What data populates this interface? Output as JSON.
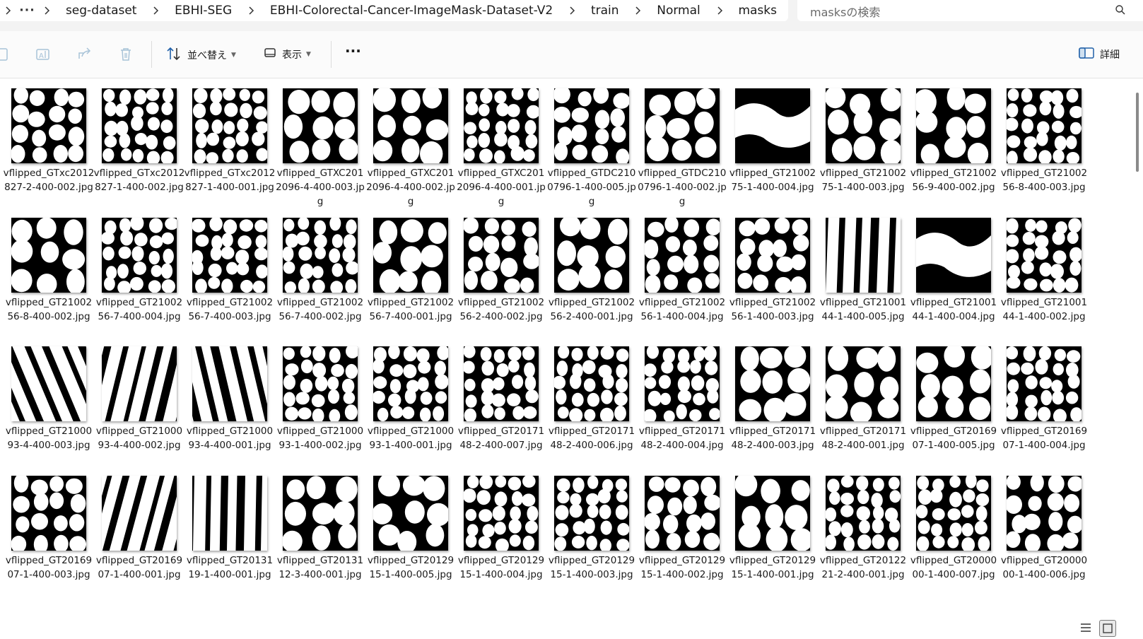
{
  "breadcrumb": {
    "overflow_label": "···",
    "items": [
      "seg-dataset",
      "EBHI-SEG",
      "EBHI-Colorectal-Cancer-ImageMask-Dataset-V2",
      "train",
      "Normal",
      "masks"
    ]
  },
  "search": {
    "placeholder": "masksの検索",
    "icon": "search-icon"
  },
  "toolbar": {
    "icons": [
      "copy-icon",
      "rename-icon",
      "share-icon",
      "delete-icon"
    ],
    "sort_label": "並べ替え",
    "view_label": "表示",
    "more_label": "···",
    "details_label": "詳細"
  },
  "files": [
    "vflipped_GTxc2012827-2-400-002.jpg",
    "vflipped_GTxc2012827-1-400-002.jpg",
    "vflipped_GTxc2012827-1-400-001.jpg",
    "vflipped_GTXC2012096-4-400-003.jpg",
    "vflipped_GTXC2012096-4-400-002.jpg",
    "vflipped_GTXC2012096-4-400-001.jpg",
    "vflipped_GTDC2100796-1-400-005.jpg",
    "vflipped_GTDC2100796-1-400-002.jpg",
    "vflipped_GT2100275-1-400-004.jpg",
    "vflipped_GT2100275-1-400-003.jpg",
    "vflipped_GT2100256-9-400-002.jpg",
    "vflipped_GT2100256-8-400-003.jpg",
    "vflipped_GT2100256-8-400-002.jpg",
    "vflipped_GT2100256-7-400-004.jpg",
    "vflipped_GT2100256-7-400-003.jpg",
    "vflipped_GT2100256-7-400-002.jpg",
    "vflipped_GT2100256-7-400-001.jpg",
    "vflipped_GT2100256-2-400-002.jpg",
    "vflipped_GT2100256-2-400-001.jpg",
    "vflipped_GT2100256-1-400-004.jpg",
    "vflipped_GT2100256-1-400-003.jpg",
    "vflipped_GT2100144-1-400-005.jpg",
    "vflipped_GT2100144-1-400-004.jpg",
    "vflipped_GT2100144-1-400-002.jpg",
    "vflipped_GT2100093-4-400-003.jpg",
    "vflipped_GT2100093-4-400-002.jpg",
    "vflipped_GT2100093-4-400-001.jpg",
    "vflipped_GT2100093-1-400-002.jpg",
    "vflipped_GT2100093-1-400-001.jpg",
    "vflipped_GT2017148-2-400-007.jpg",
    "vflipped_GT2017148-2-400-006.jpg",
    "vflipped_GT2017148-2-400-004.jpg",
    "vflipped_GT2017148-2-400-003.jpg",
    "vflipped_GT2017148-2-400-001.jpg",
    "vflipped_GT2016907-1-400-005.jpg",
    "vflipped_GT2016907-1-400-004.jpg",
    "vflipped_GT2016907-1-400-003.jpg",
    "vflipped_GT2016907-1-400-001.jpg",
    "vflipped_GT2013119-1-400-001.jpg",
    "vflipped_GT2013112-3-400-001.jpg",
    "vflipped_GT2012915-1-400-005.jpg",
    "vflipped_GT2012915-1-400-004.jpg",
    "vflipped_GT2012915-1-400-003.jpg",
    "vflipped_GT2012915-1-400-002.jpg",
    "vflipped_GT2012915-1-400-001.jpg",
    "vflipped_GT2012221-2-400-001.jpg",
    "vflipped_GT2000000-1-400-007.jpg",
    "vflipped_GT2000000-1-400-006.jpg"
  ],
  "thumbnail_pattern": [
    "blobs",
    "blobs",
    "blobs",
    "blobs",
    "blobs",
    "blobs",
    "blobs",
    "blobs",
    "block",
    "blobs",
    "blobs",
    "blobs",
    "blobs",
    "blobs",
    "blobs",
    "blobs",
    "blobs",
    "blobs",
    "blobs",
    "blobs",
    "blobs",
    "stripes",
    "block",
    "blobs",
    "stripes",
    "stripes",
    "stripes",
    "blobs",
    "blobs",
    "blobs",
    "blobs",
    "blobs",
    "blobs",
    "blobs",
    "blobs",
    "blobs",
    "blobs",
    "stripes",
    "stripes",
    "blobs",
    "blobs",
    "blobs",
    "blobs",
    "blobs",
    "blobs",
    "blobs",
    "blobs",
    "blobs"
  ],
  "colors": {
    "mask_background": "#000000",
    "mask_foreground": "#ffffff",
    "chrome": "#f3f3f3"
  },
  "status": {
    "list_view_icon": "list-view-icon",
    "tiles_view_icon": "tiles-view-icon"
  }
}
